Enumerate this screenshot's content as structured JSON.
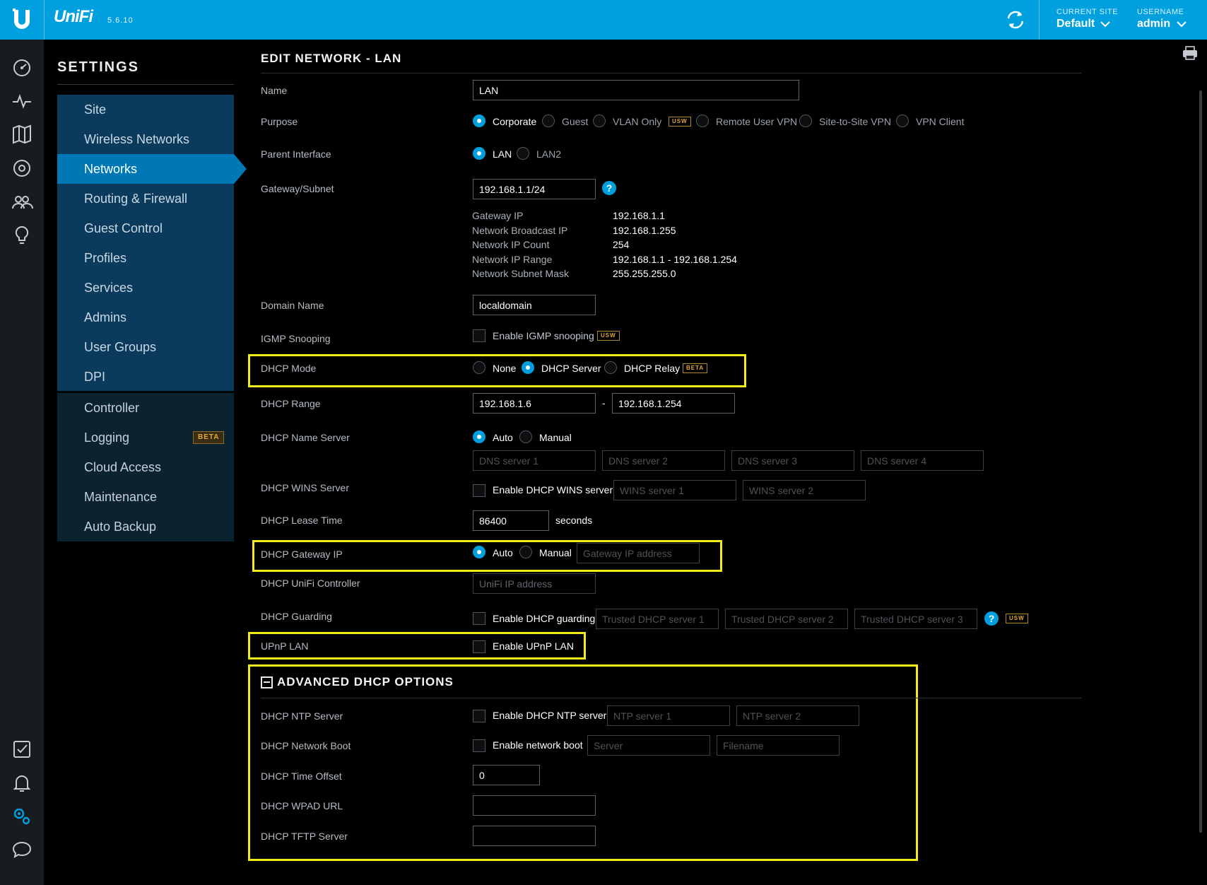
{
  "header": {
    "brand": "UniFi",
    "version": "5.6.10",
    "current_site_label": "CURRENT SITE",
    "current_site_value": "Default",
    "username_label": "USERNAME",
    "username_value": "admin"
  },
  "settings": {
    "title": "SETTINGS",
    "nav_primary": [
      {
        "label": "Site"
      },
      {
        "label": "Wireless Networks"
      },
      {
        "label": "Networks"
      },
      {
        "label": "Routing & Firewall"
      },
      {
        "label": "Guest Control"
      },
      {
        "label": "Profiles"
      },
      {
        "label": "Services"
      },
      {
        "label": "Admins"
      },
      {
        "label": "User Groups"
      },
      {
        "label": "DPI"
      }
    ],
    "nav_secondary": [
      {
        "label": "Controller"
      },
      {
        "label": "Logging",
        "badge": "BETA"
      },
      {
        "label": "Cloud Access"
      },
      {
        "label": "Maintenance"
      },
      {
        "label": "Auto Backup"
      }
    ],
    "active_item": "Networks"
  },
  "page": {
    "title": "EDIT NETWORK - LAN",
    "name": {
      "label": "Name",
      "value": "LAN"
    },
    "purpose": {
      "label": "Purpose",
      "options": [
        "Corporate",
        "Guest",
        "VLAN Only",
        "Remote User VPN",
        "Site-to-Site VPN",
        "VPN Client"
      ],
      "selected": "Corporate",
      "vlan_tag": "USW"
    },
    "parent_interface": {
      "label": "Parent Interface",
      "options": [
        "LAN",
        "LAN2"
      ],
      "selected": "LAN"
    },
    "gateway_subnet": {
      "label": "Gateway/Subnet",
      "value": "192.168.1.1/24",
      "help": "?"
    },
    "subnet_info": [
      {
        "key": "Gateway IP",
        "value": "192.168.1.1"
      },
      {
        "key": "Network Broadcast IP",
        "value": "192.168.1.255"
      },
      {
        "key": "Network IP Count",
        "value": "254"
      },
      {
        "key": "Network IP Range",
        "value": "192.168.1.1 - 192.168.1.254"
      },
      {
        "key": "Network Subnet Mask",
        "value": "255.255.255.0"
      }
    ],
    "domain_name": {
      "label": "Domain Name",
      "value": "localdomain"
    },
    "igmp": {
      "label": "IGMP Snooping",
      "checkbox_label": "Enable IGMP snooping",
      "tag": "USW",
      "checked": false
    },
    "dhcp_mode": {
      "label": "DHCP Mode",
      "options": [
        "None",
        "DHCP Server",
        "DHCP Relay"
      ],
      "selected": "DHCP Server",
      "relay_tag": "BETA"
    },
    "dhcp_range": {
      "label": "DHCP Range",
      "start": "192.168.1.6",
      "separator": "-",
      "end": "192.168.1.254"
    },
    "dhcp_name_server": {
      "label": "DHCP Name Server",
      "options": [
        "Auto",
        "Manual"
      ],
      "selected": "Auto",
      "placeholders": [
        "DNS server 1",
        "DNS server 2",
        "DNS server 3",
        "DNS server 4"
      ]
    },
    "dhcp_wins": {
      "label": "DHCP WINS Server",
      "checkbox_label": "Enable DHCP WINS server",
      "placeholders": [
        "WINS server 1",
        "WINS server 2"
      ]
    },
    "dhcp_lease": {
      "label": "DHCP Lease Time",
      "value": "86400",
      "unit": "seconds"
    },
    "dhcp_gateway": {
      "label": "DHCP Gateway IP",
      "options": [
        "Auto",
        "Manual"
      ],
      "selected": "Auto",
      "placeholder": "Gateway IP address"
    },
    "dhcp_controller": {
      "label": "DHCP UniFi Controller",
      "placeholder": "UniFi IP address"
    },
    "dhcp_guarding": {
      "label": "DHCP Guarding",
      "checkbox_label": "Enable DHCP guarding",
      "placeholders": [
        "Trusted DHCP server 1",
        "Trusted DHCP server 2",
        "Trusted DHCP server 3"
      ],
      "help": "?",
      "tag": "USW"
    },
    "upnp": {
      "label": "UPnP LAN",
      "checkbox_label": "Enable UPnP LAN"
    },
    "advanced": {
      "title": "ADVANCED DHCP OPTIONS",
      "ntp": {
        "label": "DHCP NTP Server",
        "checkbox_label": "Enable DHCP NTP server",
        "placeholders": [
          "NTP server 1",
          "NTP server 2"
        ]
      },
      "boot": {
        "label": "DHCP Network Boot",
        "checkbox_label": "Enable network boot",
        "placeholders": [
          "Server",
          "Filename"
        ]
      },
      "time_offset": {
        "label": "DHCP Time Offset",
        "value": "0"
      },
      "wpad": {
        "label": "DHCP WPAD URL",
        "value": ""
      },
      "tftp": {
        "label": "DHCP TFTP Server",
        "value": ""
      }
    }
  },
  "colors": {
    "accent": "#00a0df",
    "highlight": "#f2ea1b",
    "nav_active": "#0078b6",
    "nav_bg": "#0a3a5c"
  },
  "icons": [
    "ubiquiti-logo-icon",
    "refresh-icon",
    "chevron-down-icon",
    "dashboard-icon",
    "statistics-icon",
    "map-icon",
    "devices-icon",
    "clients-icon",
    "insights-icon",
    "events-icon",
    "alerts-icon",
    "settings-icon",
    "chat-icon",
    "print-icon",
    "collapse-icon",
    "help-icon"
  ]
}
